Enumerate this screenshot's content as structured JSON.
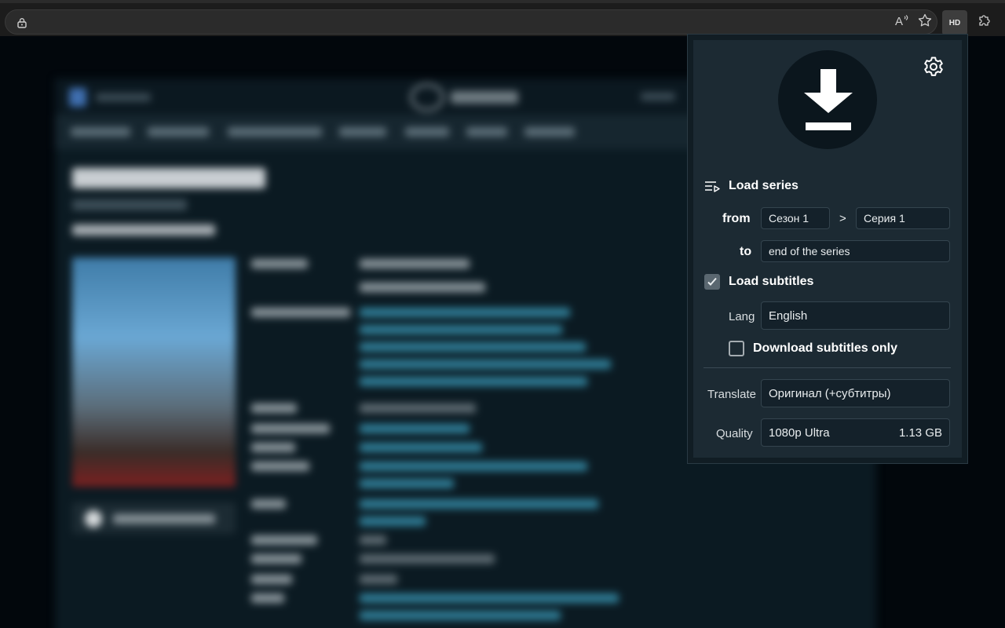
{
  "browser": {
    "extension_badge": "HD",
    "icons": [
      "lock-icon",
      "read-aloud-icon",
      "favorite-star-icon",
      "extensions-puzzle-icon"
    ]
  },
  "popup": {
    "load_series_label": "Load series",
    "from_label": "from",
    "from_season": "Сезон 1",
    "separator": ">",
    "from_episode": "Серия 1",
    "to_label": "to",
    "to_value": "end of the series",
    "load_subtitles_label": "Load subtitles",
    "load_subtitles_checked": true,
    "lang_label": "Lang",
    "lang_value": "English",
    "download_subtitles_only_label": "Download subtitles only",
    "download_subtitles_only_checked": false,
    "translate_label": "Translate",
    "translate_value": "Оригинал (+субтитры)",
    "quality_label": "Quality",
    "quality_value": "1080p Ultra",
    "quality_size": "1.13 GB"
  },
  "colors": {
    "popup_bg": "#1c2a33",
    "field_bg": "#14212a",
    "download_circle": "#0b161d"
  }
}
